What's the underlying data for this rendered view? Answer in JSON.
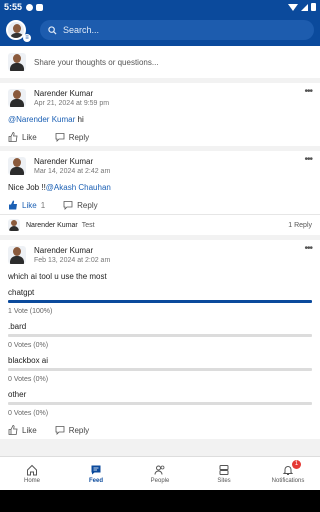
{
  "status_bar": {
    "time": "5:55"
  },
  "header": {
    "search_placeholder": "Search..."
  },
  "composer": {
    "placeholder": "Share your thoughts or questions..."
  },
  "posts": [
    {
      "author": "Narender Kumar",
      "date": "Apr 21, 2024 at 9:59 pm",
      "mention": "@Narender Kumar",
      "text": " hi",
      "like_label": "Like",
      "reply_label": "Reply"
    },
    {
      "author": "Narender Kumar",
      "date": "Mar 14, 2024 at 2:42 am",
      "text_prefix": "Nice Job !!",
      "mention": "@Akash Chauhan",
      "like_label": "Like",
      "like_count": "1",
      "reply_label": "Reply",
      "comment": {
        "author": "Narender Kumar",
        "text": "Test",
        "reply_count": "1 Reply"
      }
    },
    {
      "author": "Narender Kumar",
      "date": "Feb 13, 2024 at 2:02 am",
      "question": "which ai tool u use the most",
      "options": [
        {
          "label": "chatgpt",
          "votes": "1 Vote (100%)",
          "percent": 100
        },
        {
          "label": ".bard",
          "votes": "0 Votes (0%)",
          "percent": 0
        },
        {
          "label": "blackbox ai",
          "votes": "0 Votes (0%)",
          "percent": 0
        },
        {
          "label": "other",
          "votes": "0 Votes (0%)",
          "percent": 0
        }
      ],
      "like_label": "Like",
      "reply_label": "Reply"
    }
  ],
  "bottom_nav": [
    {
      "label": "Home",
      "icon": "home-icon"
    },
    {
      "label": "Feed",
      "icon": "feed-icon",
      "active": true
    },
    {
      "label": "People",
      "icon": "people-icon"
    },
    {
      "label": "Sites",
      "icon": "sites-icon"
    },
    {
      "label": "Notifications",
      "icon": "bell-icon",
      "badge": "1"
    }
  ],
  "colors": {
    "brand": "#0b4a9c",
    "mention": "#1a5fb4",
    "badge": "#e53935"
  }
}
